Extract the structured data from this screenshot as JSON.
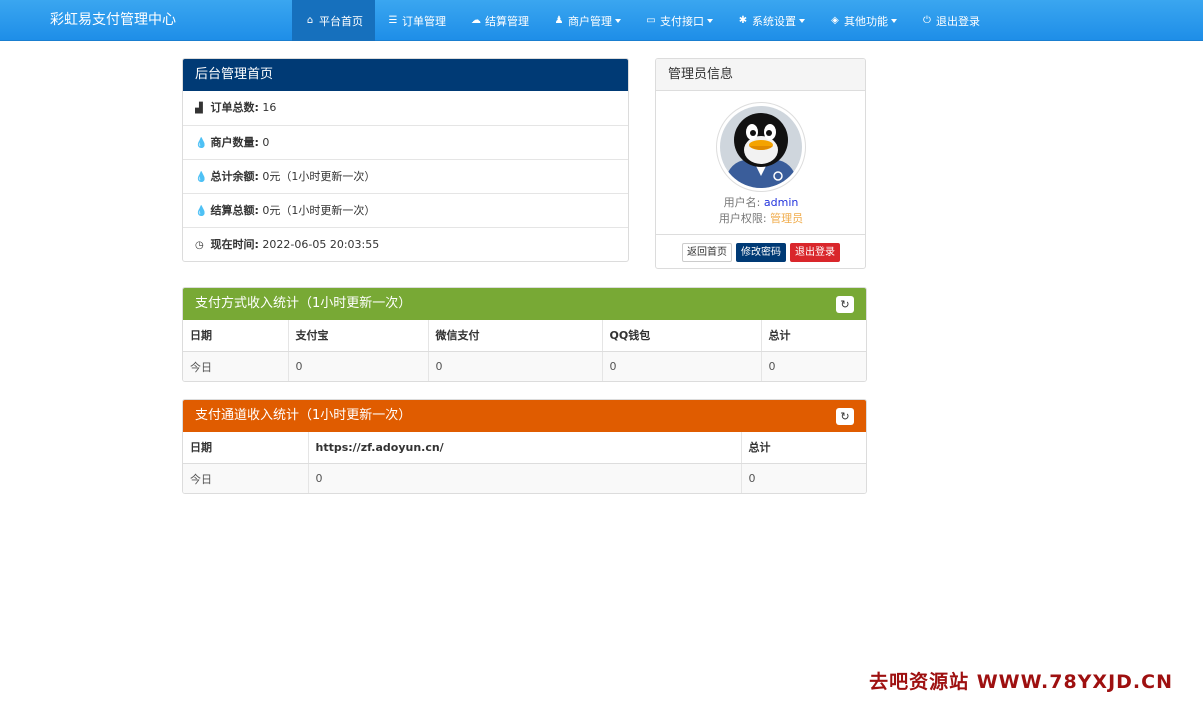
{
  "navbar": {
    "brand": "彩虹易支付管理中心",
    "items": [
      {
        "label": "平台首页",
        "icon": "home-icon"
      },
      {
        "label": "订单管理",
        "icon": "list-icon"
      },
      {
        "label": "结算管理",
        "icon": "cloud-icon"
      },
      {
        "label": "商户管理",
        "icon": "user-icon"
      },
      {
        "label": "支付接口",
        "icon": "credit-card-icon"
      },
      {
        "label": "系统设置",
        "icon": "gear-icon"
      },
      {
        "label": "其他功能",
        "icon": "cube-icon"
      },
      {
        "label": "退出登录",
        "icon": "power-icon"
      }
    ]
  },
  "dashboard": {
    "title": "后台管理首页",
    "rows": [
      {
        "label": "订单总数:",
        "value": "16",
        "icon": "bar-chart-icon"
      },
      {
        "label": "商户数量:",
        "value": "0",
        "icon": "drop-icon"
      },
      {
        "label": "总计余额:",
        "value": "0元（1小时更新一次）",
        "icon": "drop-icon"
      },
      {
        "label": "结算总额:",
        "value": "0元（1小时更新一次）",
        "icon": "drop-icon"
      },
      {
        "label": "现在时间:",
        "value": "2022-06-05 20:03:55",
        "icon": "clock-icon"
      }
    ]
  },
  "admin": {
    "title": "管理员信息",
    "username_label": "用户名:",
    "username": "admin",
    "role_label": "用户权限:",
    "role": "管理员",
    "buttons": {
      "home": "返回首页",
      "password": "修改密码",
      "logout": "退出登录"
    }
  },
  "pay_stats": {
    "title": "支付方式收入统计（1小时更新一次）",
    "headers": [
      "日期",
      "支付宝",
      "微信支付",
      "QQ钱包",
      "总计"
    ],
    "row": [
      "今日",
      "0",
      "0",
      "0",
      "0"
    ]
  },
  "channel_stats": {
    "title": "支付通道收入统计（1小时更新一次）",
    "headers": [
      "日期",
      "https://zf.adoyun.cn/",
      "总计"
    ],
    "row": [
      "今日",
      "0",
      "0"
    ]
  },
  "watermark": "去吧资源站 WWW.78YXJD.CN",
  "colors": {
    "navbar": "#2196f3",
    "dashboard_header": "#003a75",
    "pay_header": "#78a935",
    "channel_header": "#e05c00"
  }
}
